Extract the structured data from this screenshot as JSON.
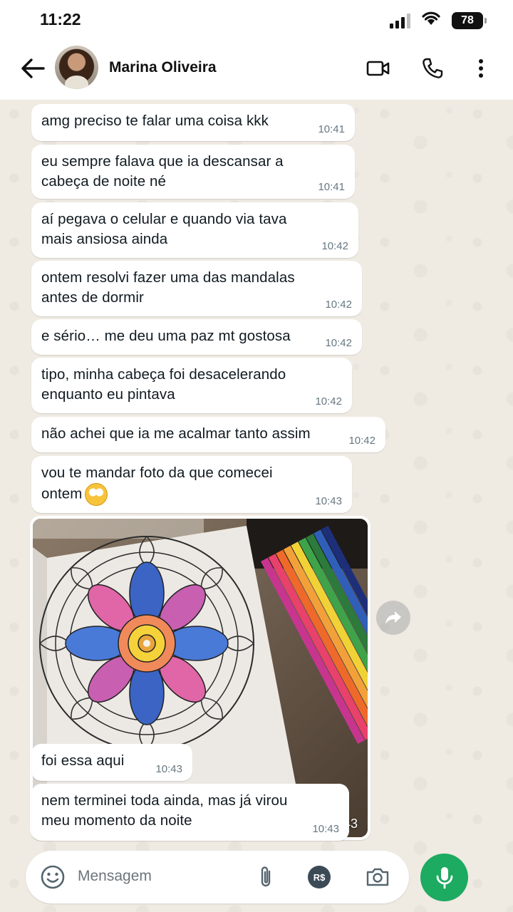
{
  "status_bar": {
    "time": "11:22",
    "battery": "78"
  },
  "header": {
    "contact_name": "Marina Oliveira"
  },
  "messages": [
    {
      "text": "amg preciso te falar uma coisa kkk",
      "time": "10:41"
    },
    {
      "text": "eu sempre falava que ia descansar a\ncabeça de noite né",
      "time": "10:41"
    },
    {
      "text": "aí pegava o celular e quando via tava\nmais ansiosa ainda",
      "time": "10:42"
    },
    {
      "text": "ontem resolvi fazer uma das mandalas\nantes de dormir",
      "time": "10:42"
    },
    {
      "text": "e sério… me deu uma paz mt gostosa",
      "time": "10:42"
    },
    {
      "text": "tipo, minha cabeça foi desacelerando\nenquanto eu pintava",
      "time": "10:42"
    },
    {
      "text": "não achei que ia me acalmar tanto assim",
      "time": "10:42"
    },
    {
      "text": "vou te mandar foto da que comecei\nontem",
      "time": "10:43",
      "emoji": "pleading-face-emoji"
    },
    {
      "text": "foi essa aqui",
      "time": "10:43"
    },
    {
      "text": "nem terminei toda ainda, mas já virou\nmeu momento da noite",
      "time": "10:43"
    }
  ],
  "image_message": {
    "time": "10:43",
    "description_icon": "mandala-photo"
  },
  "input": {
    "placeholder": "Mensagem",
    "payment_label": "R$"
  },
  "colors": {
    "bubble": "#ffffff",
    "background": "#efeae2",
    "mic": "#1daa61",
    "time": "#667781"
  }
}
